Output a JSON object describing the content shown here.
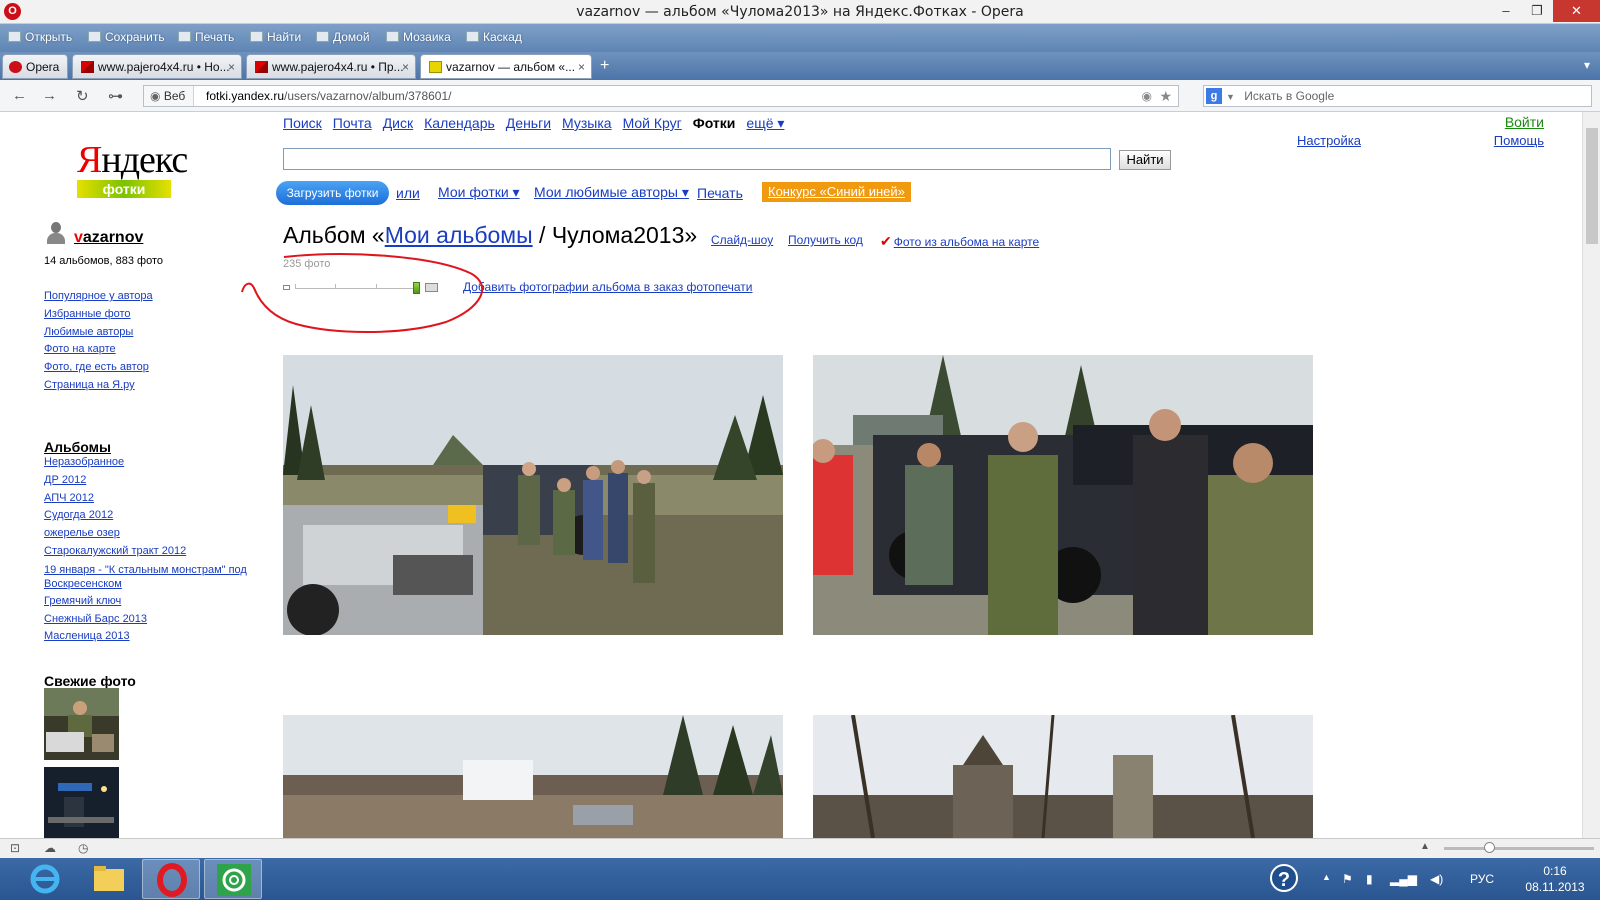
{
  "window": {
    "title": "vazarnov — альбом «Чулома2013» на Яндекс.Фотках - Opera",
    "opera_badge": "O",
    "controls": {
      "minimize": "–",
      "maximize": "❐",
      "close": "✕"
    }
  },
  "toolbar": {
    "items": [
      "Открыть",
      "Сохранить",
      "Печать",
      "Найти",
      "Домой",
      "Мозаика",
      "Каскад"
    ]
  },
  "tabs": {
    "opera_label": "Opera",
    "items": [
      {
        "label": "www.pajero4x4.ru • Но...",
        "close": "×"
      },
      {
        "label": "www.pajero4x4.ru • Пр...",
        "close": "×"
      },
      {
        "label": "vazarnov — альбом «...",
        "close": "×"
      }
    ],
    "new_tab": "+",
    "menu": "▾"
  },
  "nav": {
    "back": "←",
    "forward": "→",
    "reload": "↻",
    "key": "⊶",
    "web_label": "Веб",
    "url_host": "fotki.yandex.ru",
    "url_path": "/users/vazarnov/album/378601/",
    "rss": "◉",
    "star": "★",
    "search_engine_badge": "g",
    "search_placeholder": "Искать в Google"
  },
  "yandex": {
    "logo_first": "Я",
    "logo_rest": "ндекс",
    "logo_sub": "фотки",
    "services": [
      "Поиск",
      "Почта",
      "Диск",
      "Календарь",
      "Деньги",
      "Музыка",
      "Мой Круг",
      "Фотки",
      "ещё ▾"
    ],
    "current_service": "Фотки",
    "login": "Войти",
    "settings": "Настройка",
    "help": "Помощь",
    "search_value": "",
    "search_button": "Найти"
  },
  "actions": {
    "upload": "Загрузить фотки",
    "or": "или",
    "my_fotki": "Мои фотки ▾",
    "fav_authors": "Мои любимые авторы ▾",
    "print": "Печать",
    "contest": "Конкурс «Синий иней»"
  },
  "user": {
    "name_first": "v",
    "name_rest": "azarnov",
    "stats": "14 альбомов, 883 фото",
    "links": [
      "Популярное у автора",
      "Избранные фото",
      "Любимые авторы",
      "Фото на карте",
      "Фото, где есть автор",
      "Страница на Я.ру"
    ]
  },
  "albums": {
    "heading": "Альбомы",
    "items": [
      "Неразобранное",
      "ДР 2012",
      "АПЧ 2012",
      "Судогда 2012",
      "ожерелье озер",
      "Старокалужский тракт 2012",
      "19 января - \"К стальным монстрам\" под",
      "Воскресенском",
      "Гремячий ключ",
      "Снежный Барс 2013",
      "Масленица 2013"
    ]
  },
  "fresh": {
    "heading": "Свежие фото"
  },
  "album": {
    "title_prefix": "Альбом «",
    "title_link": "Мои альбомы",
    "title_suffix": " / Чулома2013»",
    "slideshow": "Слайд-шоу",
    "get_code": "Получить код",
    "on_map_tick": "✔",
    "on_map": "Фото из альбома на карте",
    "count": "235 фото",
    "zoom_level": 1.0,
    "print_order": "Добавить фотографии альбома в заказ фотопечати",
    "annotation_color": "#e0141c"
  },
  "status": {
    "panel_icon": "⊡",
    "cloud_icon": "☁",
    "gauge_icon": "◷",
    "up_arrow": "▲"
  },
  "taskbar": {
    "help": "?",
    "up": "▲",
    "flag": "⚑",
    "lang": "РУС",
    "time": "0:16",
    "date": "08.11.2013"
  },
  "colors": {
    "link": "#1a3dc1",
    "upload_button": "#2a84e6",
    "contest_bg": "#f29a0f",
    "login": "#1a8a10"
  }
}
